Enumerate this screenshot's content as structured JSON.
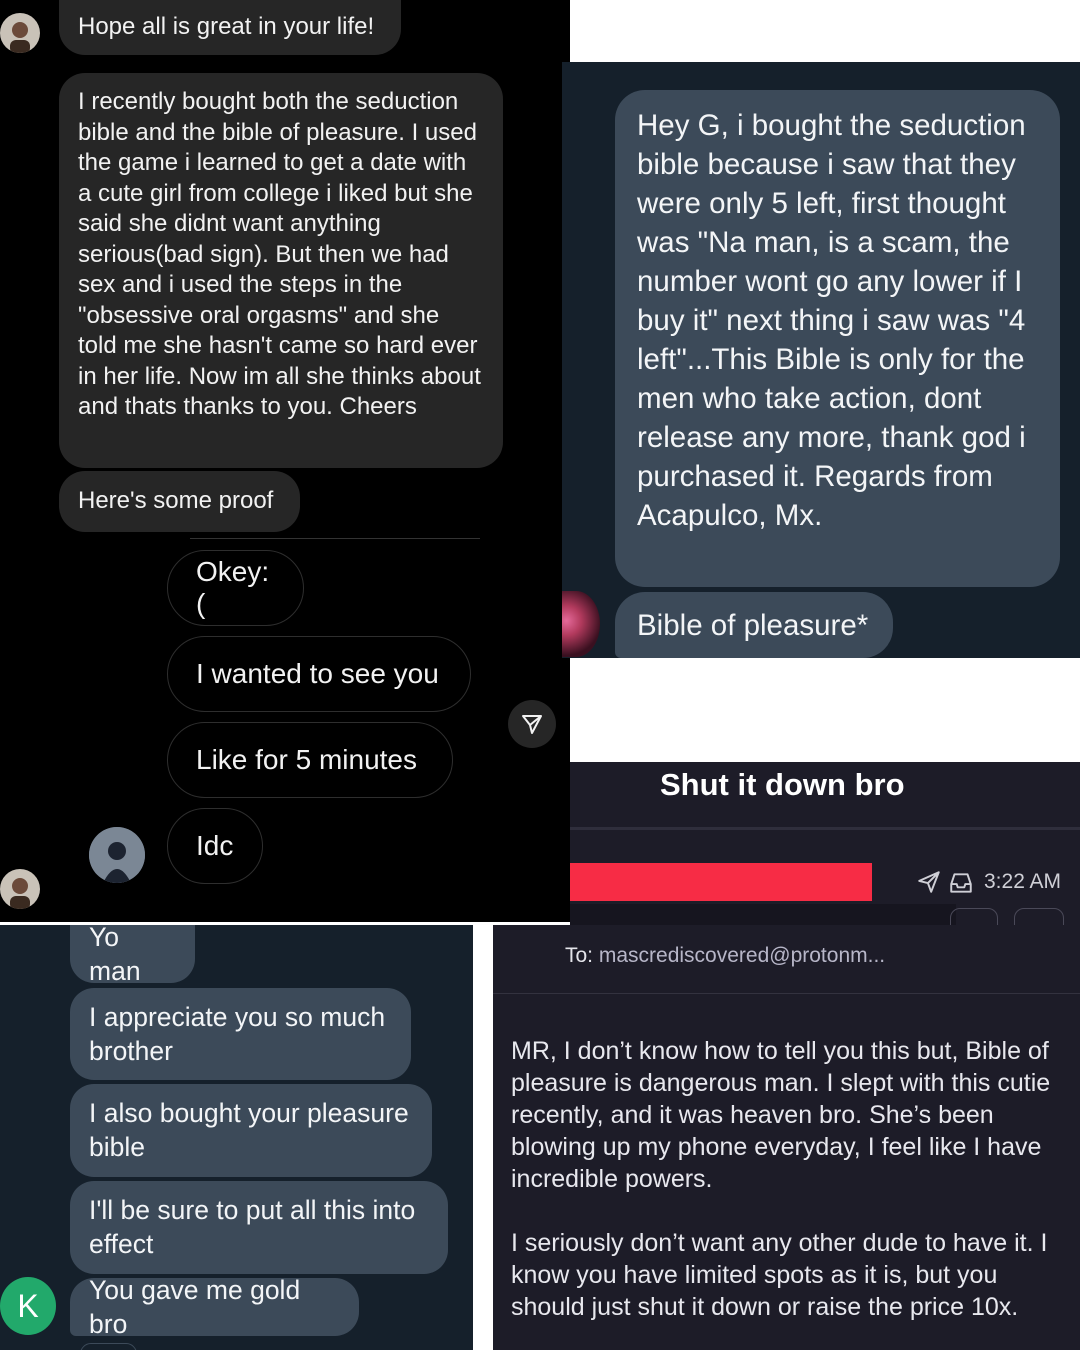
{
  "instagram": {
    "msg1": "Hope all is great in your life!",
    "msg2": "I recently bought both the seduction bible and the bible of pleasure. I used the game i learned to get a date with a cute girl from college i liked but she said she didnt want anything serious(bad sign). But then we had sex and i used the steps in the \"obsessive oral orgasms\" and she told me she hasn't came so hard ever in her life. Now im all she thinks about and thats thanks to you. Cheers",
    "msg3": "Here's some proof",
    "proof": [
      "Okey:(",
      "I wanted to see you",
      "Like for 5 minutes",
      "Idc"
    ]
  },
  "twitter_top": {
    "msg1": "Hey G, i bought the seduction bible because i saw that they were only 5 left, first thought was \"Na man, is a scam, the number wont go any lower if I buy it\" next thing i saw was \"4 left\"...This Bible is only for the men who take action, dont release any more, thank god i purchased it. Regards from Acapulco, Mx.",
    "msg2": "Bible of pleasure*"
  },
  "email": {
    "subject": "Shut it down bro",
    "time": "3:22 AM",
    "to_label": "To:",
    "to_address": "mascrediscovered@protonm...",
    "more": "···",
    "body1": "MR, I don’t know how to tell you this but, Bible of pleasure is dangerous man. I slept with this cutie recently, and it was heaven bro. She’s been blowing up my phone everyday, I feel like I have incredible powers.",
    "body2": "I seriously don’t want any other dude to have it. I know you have limited spots as it is, but you should just shut it down or raise the price 10x.",
    "colors": {
      "redaction": "#f72c45",
      "background": "#1d1c28"
    }
  },
  "twitter_bottom": {
    "avatar_letter": "K",
    "msgs": [
      "Yo man",
      "I appreciate you so much brother",
      "I also bought your pleasure bible",
      "I'll be sure to put all this into effect",
      "You gave me gold bro"
    ]
  },
  "colors": {
    "ig_bg": "#000000",
    "ig_bubble": "#262626",
    "tw_bg": "#15202b",
    "tw_bubble": "#3c4a59",
    "avatar_k": "#22a96b"
  }
}
